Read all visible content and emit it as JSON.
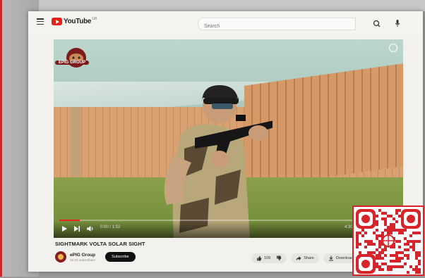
{
  "app": {
    "logo_text": "YouTube",
    "logo_sup": "GB"
  },
  "search": {
    "placeholder": "Search"
  },
  "video": {
    "overlay_logo_text": "EPIG GROUP",
    "time": "0:00 / 1:52",
    "progress_fraction": 0.06,
    "right_time": "4:30"
  },
  "title": "SIGHTMARK VOLTA SOLAR SIGHT",
  "channel": {
    "name": "ePIG Group",
    "subscribers": "16.1K subscribers",
    "subscribe_label": "Subscribe"
  },
  "actions": {
    "likes": "109",
    "share_label": "Share",
    "download_label": "Download"
  },
  "colors": {
    "brand_red": "#e62117",
    "accent_border": "#d6242a"
  }
}
